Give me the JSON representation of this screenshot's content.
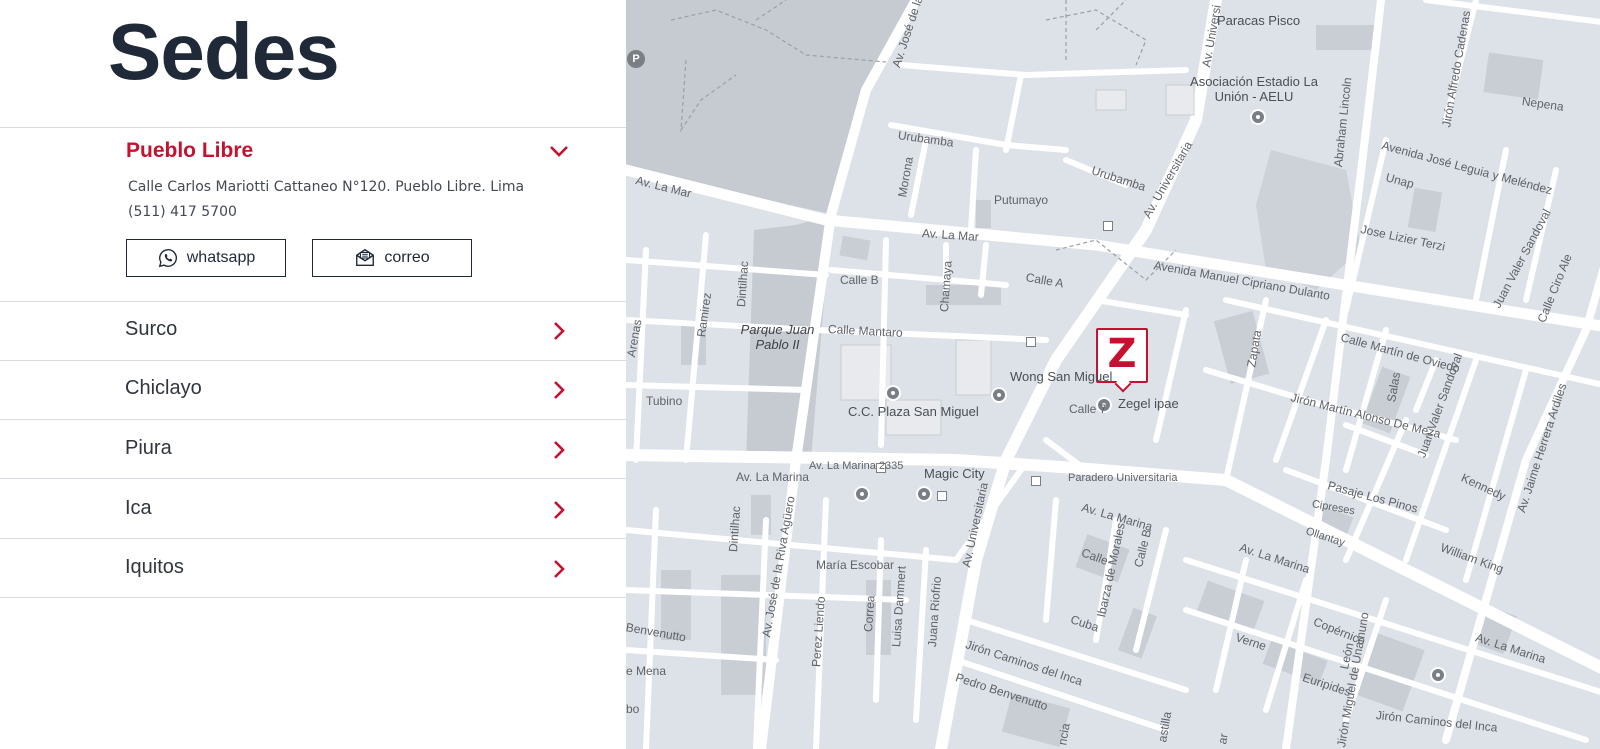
{
  "page": {
    "title": "Sedes"
  },
  "active_sede": {
    "name": "Pueblo Libre",
    "address": "Calle Carlos Mariotti Cattaneo N°120. Pueblo Libre. Lima",
    "phone": "(511) 417 5700",
    "buttons": {
      "whatsapp": "whatsapp",
      "email": "correo"
    }
  },
  "sedes": [
    {
      "label": "Surco"
    },
    {
      "label": "Chiclayo"
    },
    {
      "label": "Piura"
    },
    {
      "label": "Ica"
    },
    {
      "label": "Iquitos"
    }
  ],
  "colors": {
    "accent": "#c41230",
    "text_dark": "#1f2937",
    "map_bg": "#dde1e8",
    "road": "#ffffff",
    "block": "#c8ccd3"
  },
  "map": {
    "pin_logo": "Z",
    "pin_label": "Zegel ipae",
    "labels": {
      "paracas": "Paracas Pisco",
      "aelu": "Asociación Estadio La Unión - AELU",
      "urubamba1": "Urubamba",
      "urubamba2": "Urubamba",
      "putumayo": "Putumayo",
      "morona": "Morona",
      "avlamar1": "Av. La Mar",
      "avlamar2": "Av. La Mar",
      "avjose_top": "Av. José de la",
      "avuniv_top": "Av. Universitaria",
      "avuniv_top2": "Av. Universi",
      "avmanuel": "Avenida Manuel Cipriano Dulanto",
      "abraham": "Abraham Lincoln",
      "jironalfredo": "Jirón Alfredo Cadenas",
      "nepena": "Nepena",
      "leguia": "Avenida José Leguia y Meléndez",
      "unap": "Unap",
      "lizier": "Jose Lizier Terzi",
      "valersand1": "Juan Valer Sandoval",
      "valersand2": "Juan Valer Sandoval",
      "ciro": "Calle Ciro Ale",
      "dintilhac1": "Dintilhac",
      "dintilhac2": "Dintilhac",
      "calleb1": "Calle B",
      "chamaya": "Chamaya",
      "callea": "Calle A",
      "ramirez": "Ramirez",
      "arenas": "Arenas",
      "parque": "Parque Juan Pablo II",
      "mantaro": "Calle Mantaro",
      "wong": "Wong San Miguel",
      "plaza": "C.C. Plaza San Miguel",
      "calle7": "Calle 7",
      "tubino": "Tubino",
      "zapata": "Zapata",
      "martin": "Calle Martín de Oviedo",
      "alonso": "Jirón Martín Alonso De Meza",
      "salas": "Salas",
      "herrera": "Av. Jaime Herrera Ardiles",
      "kennedy": "Kennedy",
      "avmarina2335": "Av. La Marina 2335",
      "avmarina1": "Av. La Marina",
      "magic": "Magic City",
      "paradero": "Paradero Universitaria",
      "avmarina2": "Av. La Marina",
      "avmarina3": "Av. La Marina",
      "avmarina4": "Av. La Marina",
      "pasaje": "Pasaje Los Pinos",
      "cipreses": "Cipreses",
      "ollantay": "Ollantay",
      "william": "William King",
      "avuniv_bot": "Av. Universitaria",
      "avjose_bot": "Av. José de la Riva Agüero",
      "maria": "María Escobar",
      "luisa": "Luisa Dammert",
      "juanario": "Juana Riofrio",
      "correa": "Correa",
      "perez": "Perez Liendo",
      "callea_low": "Calle",
      "ibarza": "Ibarza de Morales",
      "calleb2": "Calle B",
      "cuba": "Cuba",
      "caminos1": "Jirón Caminos del Inca",
      "pedro": "Pedro Benvenutto",
      "benvenutto": "Benvenutto",
      "mena": "e Mena",
      "verne": "Verne",
      "copernico": "Copérnico",
      "euripides": "Euripides",
      "leon": "León",
      "unamuno": "Jirón Miguel de Unamuno",
      "caminos2": "Jirón Caminos del Inca",
      "avmarina5": "Av. La Marina",
      "castilla": "astilla",
      "incia": "ncia",
      "bo": "bo",
      "arlbl": "ar"
    }
  }
}
